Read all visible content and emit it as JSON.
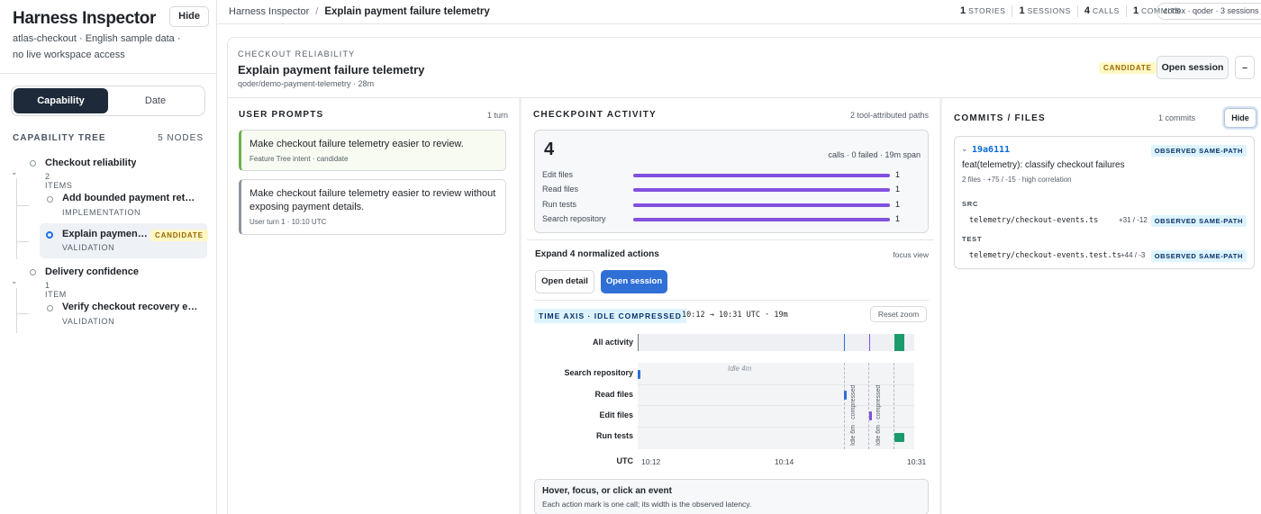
{
  "sidebar": {
    "title": "Harness Inspector",
    "hide_label": "Hide",
    "subtitle": "atlas-checkout · English sample data · no live workspace access",
    "segments": [
      "Capability",
      "Date"
    ],
    "tree_heading": "CAPABILITY TREE",
    "tree_count": "5 NODES",
    "groups": [
      {
        "title": "Checkout reliability",
        "sub": "2 ITEMS",
        "items": [
          {
            "title": "Add bounded payment retries",
            "sub": "IMPLEMENTATION",
            "badge": ""
          },
          {
            "title": "Explain payment…",
            "sub": "VALIDATION",
            "badge": "CANDIDATE"
          }
        ]
      },
      {
        "title": "Delivery confidence",
        "sub": "1 ITEM",
        "items": [
          {
            "title": "Verify checkout recovery evi…",
            "sub": "VALIDATION",
            "badge": ""
          }
        ]
      }
    ]
  },
  "topbar": {
    "crumb_root": "Harness Inspector",
    "crumb_sep": "/",
    "crumb_current": "Explain payment failure telemetry",
    "stats": [
      {
        "num": "1",
        "label": "STORIES"
      },
      {
        "num": "1",
        "label": "SESSIONS"
      },
      {
        "num": "4",
        "label": "CALLS"
      },
      {
        "num": "1",
        "label": "COMMITS"
      }
    ],
    "chip": "codex · qoder · 3 sessions"
  },
  "story": {
    "kicker": "CHECKOUT RELIABILITY",
    "title": "Explain payment failure telemetry",
    "meta": "qoder/demo-payment-telemetry · 28m",
    "badge": "CANDIDATE",
    "open_session_label": "Open session",
    "collapse_label": "–"
  },
  "prompts": {
    "heading": "USER PROMPTS",
    "count": "1 turn",
    "items": [
      {
        "text": "Make checkout failure telemetry easier to review.",
        "meta": "Feature Tree intent · candidate"
      },
      {
        "text": "Make checkout failure telemetry easier to review without exposing payment details.",
        "meta": "User turn 1 · 10:10 UTC"
      }
    ]
  },
  "checkpoint": {
    "heading": "CHECKPOINT ACTIVITY",
    "right": "2 tool-attributed paths",
    "calls": "4",
    "calls_meta": "calls · 0 failed · 19m span",
    "rows": [
      {
        "label": "Edit files",
        "value": "1",
        "frac": 1
      },
      {
        "label": "Read files",
        "value": "1",
        "frac": 1
      },
      {
        "label": "Run tests",
        "value": "1",
        "frac": 1
      },
      {
        "label": "Search repository",
        "value": "1",
        "frac": 1
      }
    ],
    "expand_label": "Expand 4 normalized actions",
    "focus_label": "focus view",
    "open_detail_label": "Open detail",
    "open_session_label": "Open session",
    "time_axis_label": "TIME AXIS · IDLE COMPRESSED",
    "time_range": "10:12 → 10:31 UTC · 19m",
    "reset_zoom_label": "Reset zoom",
    "all_activity_label": "All activity",
    "lanes": [
      "Search repository",
      "Read files",
      "Edit files",
      "Run tests"
    ],
    "idle_label": "Idle 4m",
    "compressed_label_1": "Idle 6m · compressed",
    "compressed_label_2": "Idle 6m · compressed",
    "axis_label": "UTC",
    "ticks": [
      "10:12",
      "10:14",
      "10:31"
    ],
    "hover_title": "Hover, focus, or click an event",
    "hover_sub": "Each action mark is one call; its width is the observed latency.",
    "colors": {
      "bar": "#8250df",
      "accent": "#2f6fd6",
      "test": "#1a9b6c"
    }
  },
  "commits": {
    "heading": "COMMITS / FILES",
    "count": "1 commits",
    "hide_label": "Hide",
    "hash": "19a6111",
    "badge": "OBSERVED SAME-PATH",
    "message": "feat(telemetry): classify checkout failures",
    "meta": "2 files · +75 / -15 · high correlation",
    "groups": [
      {
        "name": "SRC",
        "file": "telemetry/checkout-events.ts",
        "diff": "+31 / -12",
        "badge": "OBSERVED SAME-PATH"
      },
      {
        "name": "TEST",
        "file": "telemetry/checkout-events.test.ts",
        "diff": "+44 / -3",
        "badge": "OBSERVED SAME-PATH"
      }
    ]
  }
}
